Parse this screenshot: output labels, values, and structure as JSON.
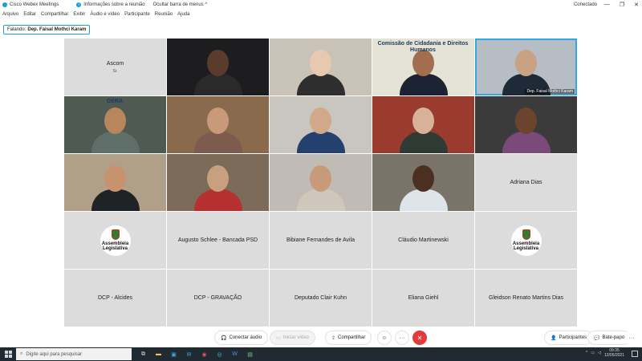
{
  "titlebar": {
    "app_title": "Cisco Webex Meetings",
    "info": "Informações sobre a reunião",
    "hide_menu": "Ocultar barra de menus",
    "status": "Conectado",
    "minimize": "—",
    "restore": "❐",
    "close": "✕"
  },
  "menu": [
    "Arquivo",
    "Editar",
    "Compartilhar",
    "Exibir",
    "Áudio e vídeo",
    "Participante",
    "Reunião",
    "Ajuda"
  ],
  "speaker": {
    "prefix": "Falando:",
    "name": "Dep. Faisal Mothci Karam"
  },
  "tiles": [
    {
      "name": "Ascom",
      "sub": "Sr.",
      "type": "name"
    },
    {
      "name": "",
      "type": "video",
      "bg": "#1d1d1f",
      "skin": "#5a3b2c",
      "shirt": "#2a2a2a"
    },
    {
      "name": "",
      "type": "video",
      "bg": "#c9c2b6",
      "skin": "#e7c9b0",
      "shirt": "#2e2e2e"
    },
    {
      "name": "",
      "type": "video",
      "bg": "#e5e2d6",
      "skin": "#a36d50",
      "shirt": "#1c2433",
      "banner": "Comissão de Cidadania e Direitos Humanos"
    },
    {
      "name": "Dep. Faisal Mothci Karam",
      "type": "video",
      "bg": "#b7bdc4",
      "skin": "#c9a283",
      "shirt": "#1f2a38",
      "active": true
    },
    {
      "name": "",
      "type": "video",
      "bg": "#4f5a52",
      "skin": "#b7865c",
      "shirt": "#5f6f6a",
      "banner": "GERA"
    },
    {
      "name": "",
      "type": "video",
      "bg": "#8a6a4c",
      "skin": "#c99a7a",
      "shirt": "#7d5c50"
    },
    {
      "name": "",
      "type": "video",
      "bg": "#c8c6be",
      "skin": "#d1a98a",
      "shirt": "#23406f"
    },
    {
      "name": "",
      "type": "video",
      "bg": "#9a3b2f",
      "skin": "#d7b299",
      "shirt": "#2f3a33"
    },
    {
      "name": "",
      "type": "video",
      "bg": "#3b3b3b",
      "skin": "#6b442e",
      "shirt": "#7a4a7a"
    },
    {
      "name": "",
      "type": "video",
      "bg": "#b0a089",
      "skin": "#c9926e",
      "shirt": "#1f2326"
    },
    {
      "name": "",
      "type": "video",
      "bg": "#7b6b58",
      "skin": "#c9a07f",
      "shirt": "#b53030"
    },
    {
      "name": "",
      "type": "video",
      "bg": "#c0bcb5",
      "skin": "#c79a7a",
      "shirt": "#cfc7bb"
    },
    {
      "name": "",
      "type": "video",
      "bg": "#7a7468",
      "skin": "#4b3022",
      "shirt": "#dfe4ea"
    },
    {
      "name": "Adriana Dias",
      "type": "name"
    },
    {
      "name": "",
      "type": "logo",
      "logo_lines": [
        "Assembleia",
        "Legislativa"
      ]
    },
    {
      "name": "Augusto Schlee - Bancada PSD",
      "type": "name"
    },
    {
      "name": "Bibiane Fernandes de Avila",
      "type": "name"
    },
    {
      "name": "Cláudio Martinewski",
      "type": "name"
    },
    {
      "name": "",
      "type": "logo",
      "logo_lines": [
        "Assembleia",
        "Legislativa"
      ]
    },
    {
      "name": "DCP - Alcides",
      "type": "name"
    },
    {
      "name": "DCP - GRAVAÇÃO",
      "type": "name"
    },
    {
      "name": "Deputado Clair Kuhn",
      "type": "name"
    },
    {
      "name": "Eliana Giehl",
      "type": "name"
    },
    {
      "name": "Gleidson Renato Martins Dias",
      "type": "name"
    }
  ],
  "toolbar": {
    "audio": "Conectar áudio",
    "video": "Iniciar vídeo",
    "share": "Compartilhar",
    "participants": "Participantes",
    "chat": "Bate-papo",
    "more": "···",
    "emoji": "☺",
    "end": "✕"
  },
  "taskbar": {
    "search_placeholder": "Digite aqui para pesquisar",
    "time": "09:35",
    "date": "12/05/2021"
  },
  "colors": {
    "accent": "#33a7e0",
    "end_call": "#e23b3b",
    "tile_bg": "#dcdcdc",
    "taskbar": "#1f2a33"
  }
}
